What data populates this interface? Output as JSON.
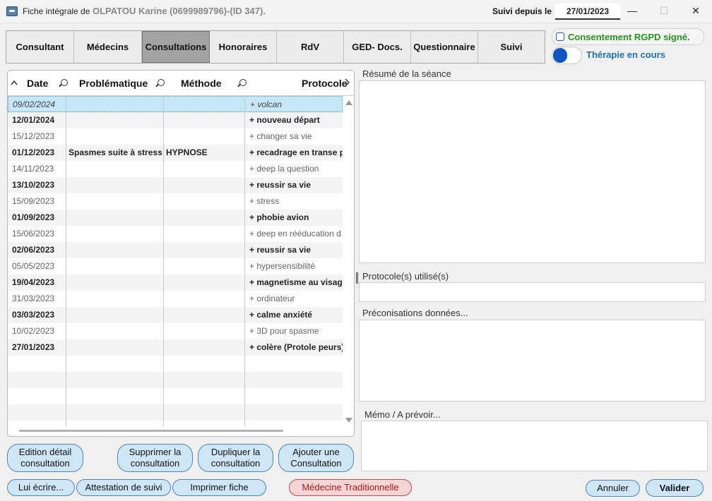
{
  "window": {
    "title_prefix": "Fiche intégrale de",
    "title_name": "OLPATOU Karine (0699989796)-(ID 347).",
    "since_label": "Suivi depuis le",
    "since_date": "27/01/2023",
    "minimize_glyph": "—",
    "maximize_glyph": "☐",
    "close_glyph": "✕"
  },
  "tabs": [
    {
      "label": "Consultant"
    },
    {
      "label": "Médecins"
    },
    {
      "label": "Consultations"
    },
    {
      "label": "Honoraires"
    },
    {
      "label": "RdV"
    },
    {
      "label": "GED- Docs."
    },
    {
      "label": "Questionnaire"
    },
    {
      "label": "Suivi"
    }
  ],
  "active_tab": "Consultations",
  "flags": {
    "rgpd_label": "Consentement RGPD signé.",
    "rgpd_checked": false,
    "therapy_label": "Thérapie en cours",
    "therapy_on": true
  },
  "table": {
    "headers": {
      "date": "Date",
      "problem": "Problématique",
      "method": "Méthode",
      "protocol": "Protocole"
    },
    "rows": [
      {
        "date": "09/02/2024",
        "problem": "",
        "method": "",
        "protocol": "+ volcan",
        "style": "selected"
      },
      {
        "date": "12/01/2024",
        "problem": "",
        "method": "",
        "protocol": "+ nouveau départ",
        "style": "bold"
      },
      {
        "date": "15/12/2023",
        "problem": "",
        "method": "",
        "protocol": "+ changer sa vie",
        "style": "grey"
      },
      {
        "date": "01/12/2023",
        "problem": "Spasmes suite à stress",
        "method": "HYPNOSE",
        "protocol": "+ recadrage en transe p",
        "style": "bold"
      },
      {
        "date": "14/11/2023",
        "problem": "",
        "method": "",
        "protocol": "+ deep la question",
        "style": "grey"
      },
      {
        "date": "13/10/2023",
        "problem": "",
        "method": "",
        "protocol": "+ reussir sa vie",
        "style": "bold"
      },
      {
        "date": "15/09/2023",
        "problem": "",
        "method": "",
        "protocol": "+ stress",
        "style": "grey"
      },
      {
        "date": "01/09/2023",
        "problem": "",
        "method": "",
        "protocol": "+ phobie avion",
        "style": "bold"
      },
      {
        "date": "15/06/2023",
        "problem": "",
        "method": "",
        "protocol": "+ deep en rééducation d",
        "style": "grey"
      },
      {
        "date": "02/06/2023",
        "problem": "",
        "method": "",
        "protocol": "+ reussir sa vie",
        "style": "bold"
      },
      {
        "date": "05/05/2023",
        "problem": "",
        "method": "",
        "protocol": "+ hypersensibilité",
        "style": "grey"
      },
      {
        "date": "19/04/2023",
        "problem": "",
        "method": "",
        "protocol": "+ magnetisme au visage",
        "style": "bold"
      },
      {
        "date": "31/03/2023",
        "problem": "",
        "method": "",
        "protocol": "+ ordinateur",
        "style": "grey"
      },
      {
        "date": "03/03/2023",
        "problem": "",
        "method": "",
        "protocol": "+ calme anxiété",
        "style": "bold"
      },
      {
        "date": "10/02/2023",
        "problem": "",
        "method": "",
        "protocol": "+ 3D pour spasme",
        "style": "grey"
      },
      {
        "date": "27/01/2023",
        "problem": "",
        "method": "",
        "protocol": "+ colère (Protole peurs)",
        "style": "bold"
      },
      {
        "date": "",
        "problem": "",
        "method": "",
        "protocol": "",
        "style": "empty"
      },
      {
        "date": "",
        "problem": "",
        "method": "",
        "protocol": "",
        "style": "empty"
      },
      {
        "date": "",
        "problem": "",
        "method": "",
        "protocol": "",
        "style": "empty"
      },
      {
        "date": "",
        "problem": "",
        "method": "",
        "protocol": "",
        "style": "empty"
      }
    ]
  },
  "fields": {
    "summary_label": "Résumé de la séance",
    "protocols_label": "Protocole(s) utilisé(s)",
    "recommendations_label": "Préconisations données...",
    "memo_label": "Mémo / A prévoir..."
  },
  "buttons": {
    "edit_detail": "Edition détail consultation",
    "delete": "Supprimer la consultation",
    "duplicate": "Dupliquer la consultation",
    "add": "Ajouter une Consultation",
    "write": "Lui écrire...",
    "certificate": "Attestation de suivi",
    "print": "Imprimer fiche",
    "traditional": "Médecine Traditionnelle",
    "cancel": "Annuler",
    "validate": "Valider"
  },
  "colors": {
    "selected_row": "#c6e6f9",
    "button_fill": "#cfe6f7",
    "rgpd_green": "#27941e",
    "therapy_blue": "#1a73b3",
    "danger_red": "#b11a1a"
  }
}
